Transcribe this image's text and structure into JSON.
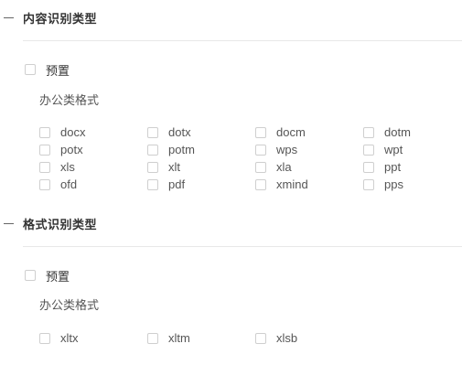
{
  "sections": [
    {
      "title": "内容识别类型",
      "preset_label": "预置",
      "group_label": "办公类格式",
      "formats": [
        "docx",
        "dotx",
        "docm",
        "dotm",
        "potx",
        "potm",
        "wps",
        "wpt",
        "xls",
        "xlt",
        "xla",
        "ppt",
        "ofd",
        "pdf",
        "xmind",
        "pps"
      ]
    },
    {
      "title": "格式识别类型",
      "preset_label": "预置",
      "group_label": "办公类格式",
      "formats": [
        "xltx",
        "xltm",
        "xlsb"
      ]
    }
  ]
}
